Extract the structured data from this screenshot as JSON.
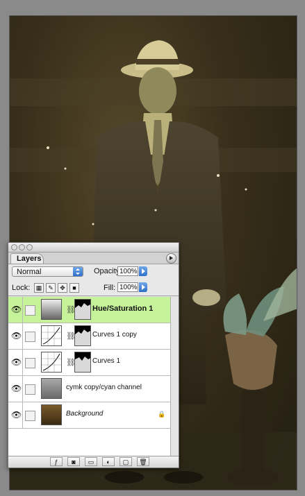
{
  "panel": {
    "tab_label": "Layers",
    "blend_mode": "Normal",
    "opacity_label": "Opacity:",
    "opacity_value": "100%",
    "lock_label": "Lock:",
    "fill_label": "Fill:",
    "fill_value": "100%"
  },
  "layers": [
    {
      "name": "Hue/Saturation 1",
      "selected": true,
      "style": "bold",
      "type": "adjustment-hue"
    },
    {
      "name": "Curves 1 copy",
      "selected": false,
      "style": "normal",
      "type": "adjustment-curves"
    },
    {
      "name": "Curves 1",
      "selected": false,
      "style": "normal",
      "type": "adjustment-curves"
    },
    {
      "name": "cymk copy/cyan channel",
      "selected": false,
      "style": "normal",
      "type": "image"
    },
    {
      "name": "Background",
      "selected": false,
      "style": "italic",
      "type": "image-locked"
    }
  ],
  "icons": {
    "visibility": "eye-icon",
    "link": "chain-link-icon",
    "lock": "lock-icon",
    "menu": "panel-menu-icon"
  },
  "colors": {
    "selected_layer": "#c6f39a",
    "photo_tint": "#5a4a2a"
  }
}
